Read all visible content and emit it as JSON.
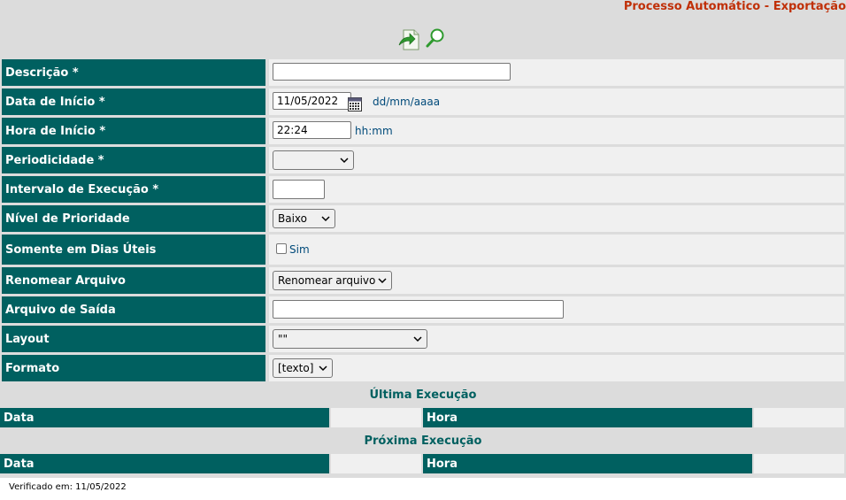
{
  "header": {
    "title": "Processo Automático - Exportação"
  },
  "toolbar": {
    "icons": [
      "export-file-icon",
      "search-icon"
    ]
  },
  "form": {
    "descricao": {
      "label": "Descrição *",
      "value": ""
    },
    "data_inicio": {
      "label": "Data de Início *",
      "value": "11/05/2022",
      "hint": "dd/mm/aaaa"
    },
    "hora_inicio": {
      "label": "Hora de Início *",
      "value": "22:24",
      "hint": "hh:mm"
    },
    "periodicidade": {
      "label": "Periodicidade *",
      "selected": ""
    },
    "intervalo": {
      "label": "Intervalo de Execução *",
      "value": ""
    },
    "prioridade": {
      "label": "Nível de Prioridade",
      "selected": "Baixo"
    },
    "dias_uteis": {
      "label": "Somente em Dias Úteis",
      "checkbox_label": "Sim",
      "checked": false
    },
    "renomear": {
      "label": "Renomear Arquivo",
      "selected": "Renomear arquivo"
    },
    "arquivo_saida": {
      "label": "Arquivo de Saída",
      "value": ""
    },
    "layout": {
      "label": "Layout",
      "selected": "\"\""
    },
    "formato": {
      "label": "Formato",
      "selected": "[texto]"
    }
  },
  "ultima": {
    "title": "Última Execução",
    "data_label": "Data",
    "data_value": "",
    "hora_label": "Hora",
    "hora_value": ""
  },
  "proxima": {
    "title": "Próxima Execução",
    "data_label": "Data",
    "data_value": "",
    "hora_label": "Hora",
    "hora_value": ""
  },
  "footer": {
    "text": "Verificado em: 11/05/2022"
  },
  "colors": {
    "label_bg": "#006060",
    "title": "#c03008",
    "value_bg": "#f0f0f0",
    "page_bg": "#dcdcdc",
    "hint": "#004a7a"
  }
}
